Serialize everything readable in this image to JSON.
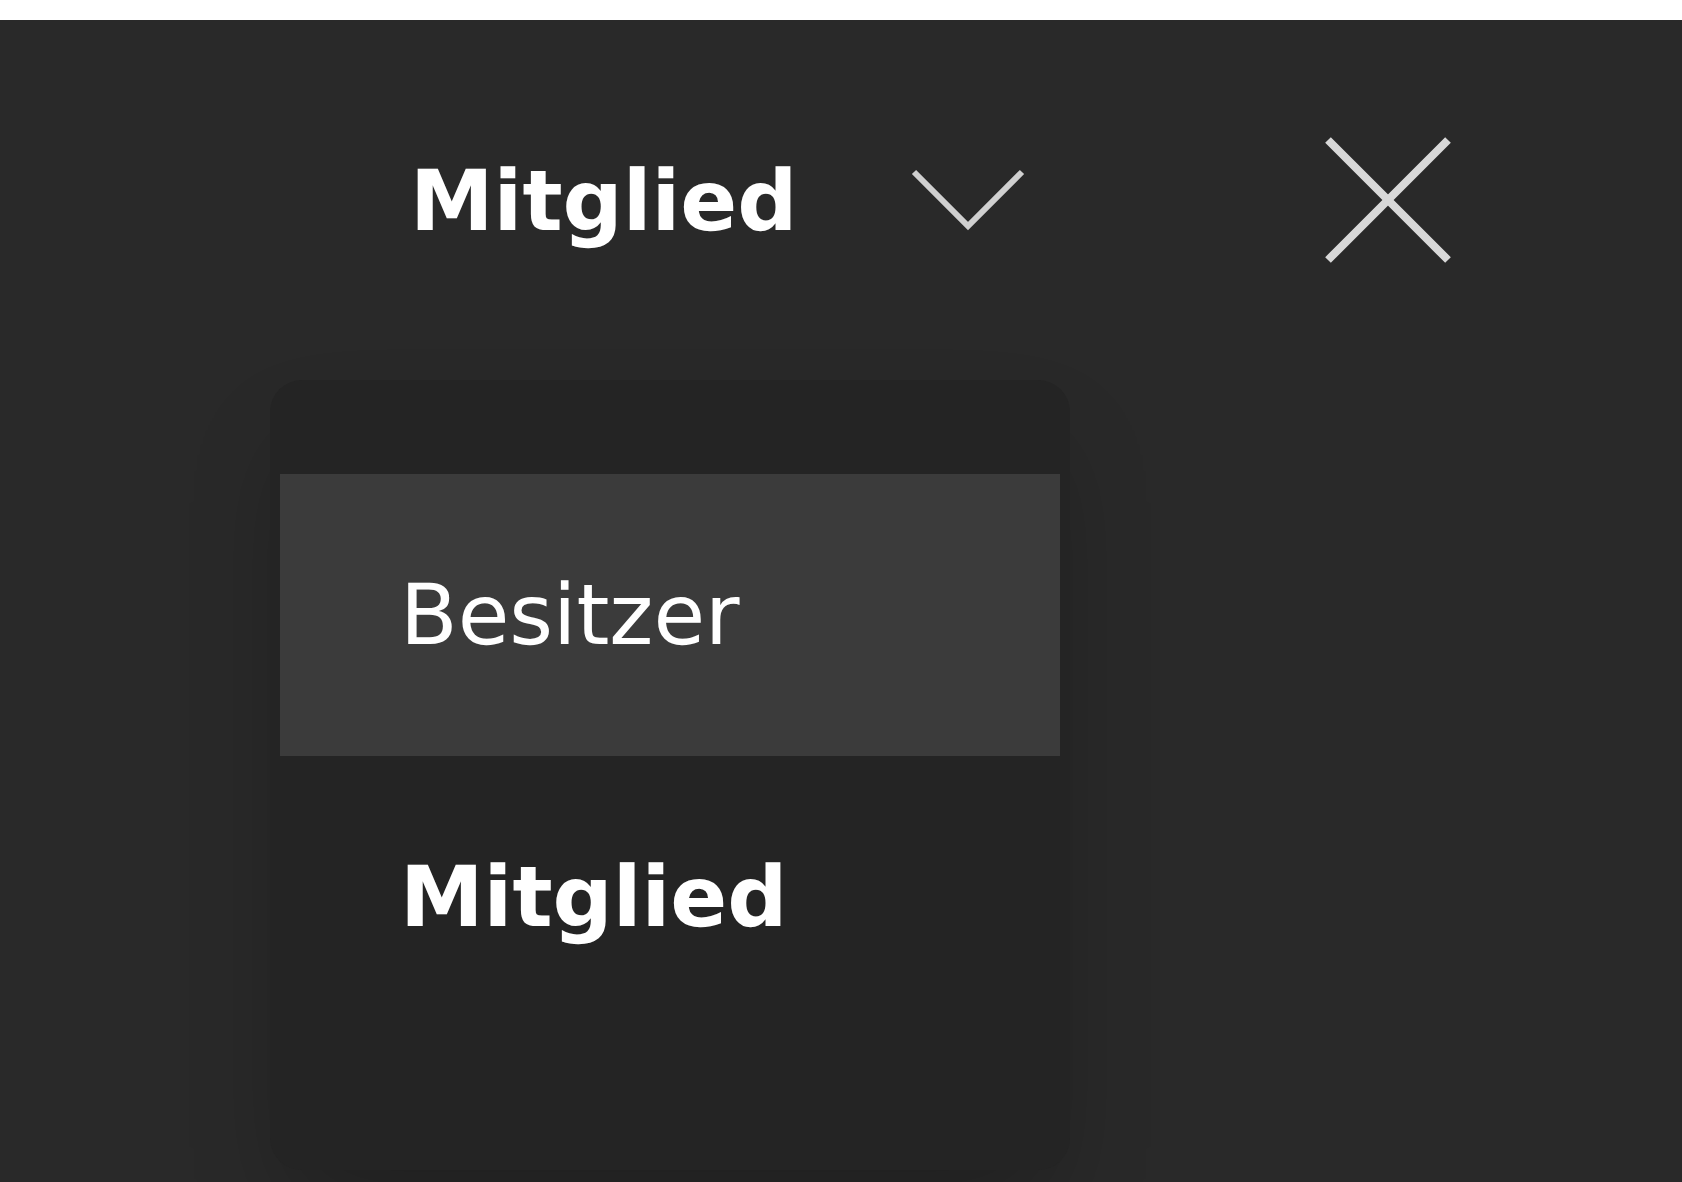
{
  "role_picker": {
    "value": "Mitglied",
    "expanded": true
  },
  "menu": {
    "items": [
      {
        "label": "Besitzer",
        "selected": false,
        "hovered": true
      },
      {
        "label": "Mitglied",
        "selected": true,
        "hovered": false
      }
    ]
  }
}
